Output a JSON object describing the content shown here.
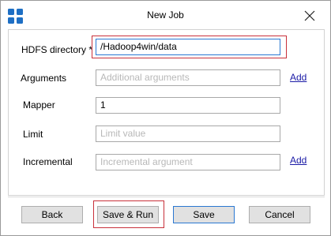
{
  "window": {
    "title": "New Job",
    "icon": "app-grid-icon",
    "close_icon": "close-icon"
  },
  "form": {
    "hdfs_directory": {
      "label": "HDFS directory *",
      "value": "/Hadoop4win/data"
    },
    "arguments": {
      "label": "Arguments",
      "placeholder": "Additional arguments",
      "add_link": "Add"
    },
    "mapper": {
      "label": "Mapper",
      "value": "1"
    },
    "limit": {
      "label": "Limit",
      "placeholder": "Limit value"
    },
    "incremental": {
      "label": "Incremental",
      "placeholder": "Incremental argument",
      "add_link": "Add"
    }
  },
  "buttons": {
    "back": "Back",
    "save_run": "Save & Run",
    "save": "Save",
    "cancel": "Cancel"
  },
  "colors": {
    "accent_blue": "#2a78d2",
    "highlight_red": "#c8303a",
    "link": "#1a1aa6"
  }
}
